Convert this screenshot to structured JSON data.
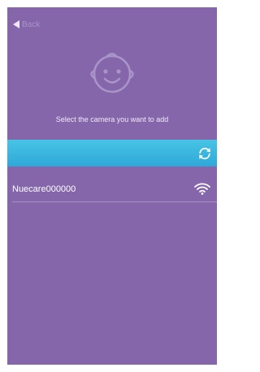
{
  "nav": {
    "back_label": "Back",
    "back_icon": "back-arrow-icon"
  },
  "header": {
    "icon": "baby-face-icon",
    "prompt": "Select the camera you want to add"
  },
  "toolbar": {
    "refresh_icon": "refresh-icon",
    "color": "#3ab6e0"
  },
  "cameras": [
    {
      "name": "Nuecare000000",
      "signal_icon": "wifi-icon"
    }
  ],
  "colors": {
    "background": "#8566ab",
    "accent": "#3ab6e0"
  }
}
